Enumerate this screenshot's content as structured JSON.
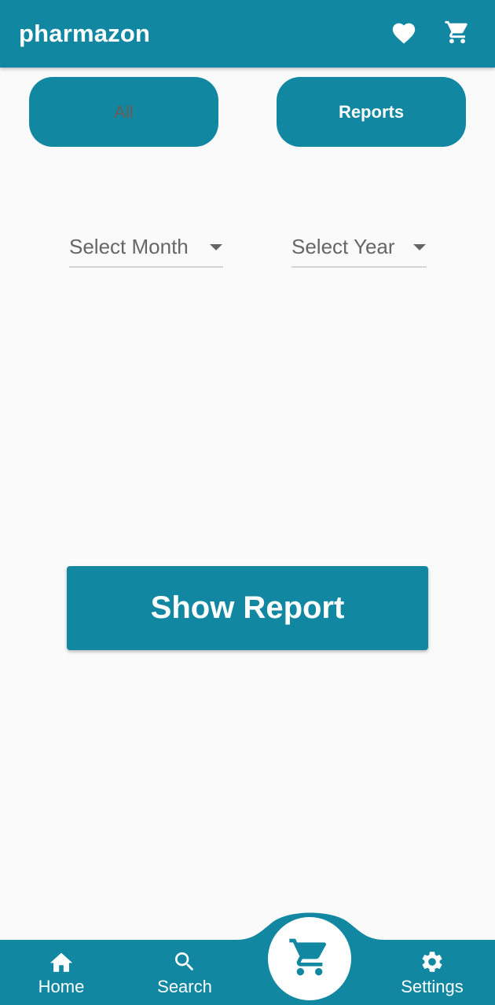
{
  "app": {
    "title": "pharmazon"
  },
  "appbar": {
    "actions": [
      {
        "icon": "heart-icon"
      },
      {
        "icon": "cart-icon"
      }
    ]
  },
  "tabs": {
    "all_label": "All",
    "reports_label": "Reports"
  },
  "filters": {
    "month": {
      "label": "Select Month",
      "icon": "dropdown-caret-icon"
    },
    "year": {
      "label": "Select Year",
      "icon": "dropdown-caret-icon"
    }
  },
  "show_report_label": "Show Report",
  "bottom_nav": {
    "items": [
      {
        "label": "Home",
        "icon": "home-icon"
      },
      {
        "label": "Search",
        "icon": "search-icon"
      },
      {
        "label": "Settings",
        "icon": "gear-icon"
      }
    ],
    "fab_icon": "cart-icon"
  },
  "colors": {
    "primary": "#1187a1",
    "background": "#fafafa",
    "tab_inactive_text": "#6b5b55",
    "on_primary": "#ffffff"
  }
}
